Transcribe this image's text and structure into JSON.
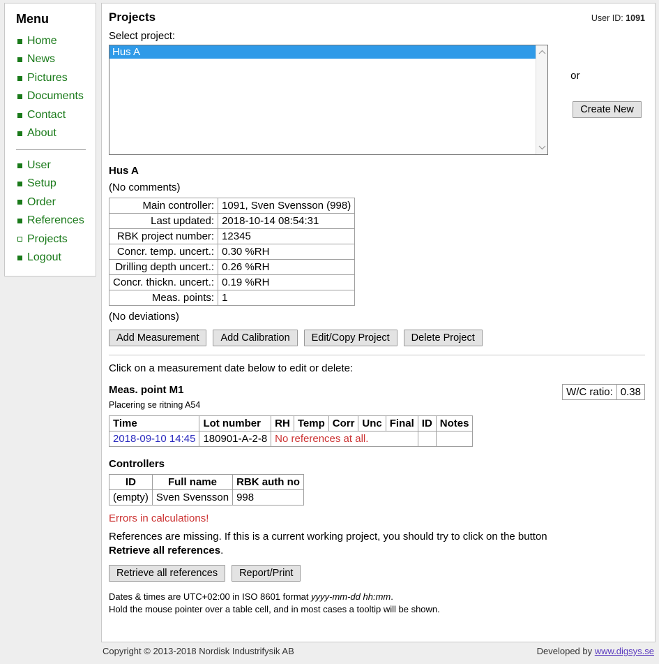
{
  "sidebar": {
    "title": "Menu",
    "group1": [
      {
        "label": "Home",
        "bullet": "filled-square-icon"
      },
      {
        "label": "News",
        "bullet": "filled-square-icon"
      },
      {
        "label": "Pictures",
        "bullet": "filled-square-icon"
      },
      {
        "label": "Documents",
        "bullet": "filled-square-icon"
      },
      {
        "label": "Contact",
        "bullet": "filled-square-icon"
      },
      {
        "label": "About",
        "bullet": "filled-square-icon"
      }
    ],
    "group2": [
      {
        "label": "User",
        "bullet": "filled-square-icon"
      },
      {
        "label": "Setup",
        "bullet": "filled-square-icon"
      },
      {
        "label": "Order",
        "bullet": "filled-square-icon"
      },
      {
        "label": "References",
        "bullet": "filled-square-icon"
      },
      {
        "label": "Projects",
        "bullet": "hollow-square-icon"
      },
      {
        "label": "Logout",
        "bullet": "filled-square-icon"
      }
    ],
    "accent_color": "#1a7a1a"
  },
  "header": {
    "title": "Projects",
    "user_id_label": "User ID:",
    "user_id_value": "1091"
  },
  "select_project": {
    "label": "Select project:",
    "options": [
      "Hus A"
    ],
    "selected": "Hus A",
    "selection_color": "#2f9ae8",
    "or_text": "or",
    "create_new_label": "Create New",
    "scroll_up_icon": "chevron-up-icon",
    "scroll_down_icon": "chevron-down-icon"
  },
  "project": {
    "name": "Hus A",
    "comments": "(No comments)",
    "deviations": "(No deviations)",
    "properties": [
      {
        "key": "Main controller:",
        "value": "1091, Sven Svensson (998)"
      },
      {
        "key": "Last updated:",
        "value": "2018-10-14 08:54:31"
      },
      {
        "key": "RBK project number:",
        "value": "12345"
      },
      {
        "key": "Concr. temp. uncert.:",
        "value": "0.30 %RH"
      },
      {
        "key": "Drilling depth uncert.:",
        "value": "0.26 %RH"
      },
      {
        "key": "Concr. thickn. uncert.:",
        "value": "0.19 %RH"
      },
      {
        "key": "Meas. points:",
        "value": "1"
      }
    ],
    "actions": [
      "Add Measurement",
      "Add Calibration",
      "Edit/Copy Project",
      "Delete Project"
    ]
  },
  "measurements": {
    "hint": "Click on a measurement date below to edit or delete:",
    "point_title": "Meas. point M1",
    "point_subtitle": "Placering se ritning A54",
    "wc_label": "W/C ratio:",
    "wc_value": "0.38",
    "columns": [
      "Time",
      "Lot number",
      "RH",
      "Temp",
      "Corr",
      "Unc",
      "Final",
      "ID",
      "Notes"
    ],
    "rows": [
      {
        "time": "2018-09-10 14:45",
        "lot_number": "180901-A-2-8",
        "message": "No references at all.",
        "message_color": "#cc3333",
        "id": "",
        "notes": ""
      }
    ]
  },
  "controllers": {
    "title": "Controllers",
    "columns": [
      "ID",
      "Full name",
      "RBK auth no"
    ],
    "rows": [
      {
        "id": "(empty)",
        "full_name": "Sven Svensson",
        "rbk_auth_no": "998"
      }
    ]
  },
  "status": {
    "error_heading": "Errors in calculations!",
    "error_color": "#cc3333",
    "message_part1": "References are missing. If this is a current working project, you should try to click on the button",
    "message_bold": "Retrieve all references",
    "message_part2": ".",
    "buttons": [
      "Retrieve all references",
      "Report/Print"
    ]
  },
  "notes": {
    "line1_pre": "Dates & times are UTC+02:00 in ISO 8601 format ",
    "line1_italic": "yyyy-mm-dd hh:mm",
    "line1_post": ".",
    "line2": "Hold the mouse pointer over a table cell, and in most cases a tooltip will be shown."
  },
  "footer": {
    "copyright": "Copyright © 2013-2018 Nordisk Industrifysik AB",
    "developed_by": "Developed by",
    "developer_link": "www.digsys.se"
  }
}
